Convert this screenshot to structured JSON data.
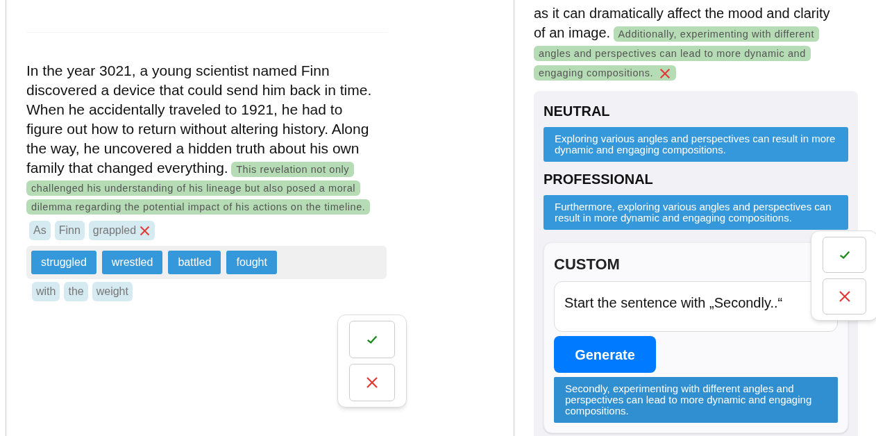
{
  "left_screen": {
    "story_text": "In the year 3021, a young scientist named Finn discovered a device that could send him back in time. When he accidentally traveled to 1921, he had to figure out how to return without altering history. Along the way, he uncovered a hidden truth about his own family that changed everything.",
    "suggestion": {
      "text": "This revelation not only challenged his understanding of his lineage but also posed a moral dilemma regarding the potential impact of his actions on the timeline.",
      "removable": false
    },
    "words": [
      {
        "text": "As",
        "removable": false
      },
      {
        "text": "Finn",
        "removable": false
      },
      {
        "text": "grappled",
        "removable": true
      }
    ],
    "options": [
      "struggled",
      "wrestled",
      "battled",
      "fought"
    ],
    "next_words": [
      {
        "text": "with",
        "removable": false
      },
      {
        "text": "the",
        "removable": false
      },
      {
        "text": "weight",
        "removable": false
      }
    ]
  },
  "right_screen": {
    "story_text": "as it can dramatically affect the mood and clarity of an image.",
    "suggestion": {
      "text": "Additionally, experimenting with different angles and perspectives can lead to more dynamic and engaging compositions.",
      "removable": true
    },
    "styles": [
      {
        "title": "NEUTRAL",
        "text": "Exploring various angles and perspectives can result in more dynamic and engaging compositions."
      },
      {
        "title": "PROFESSIONAL",
        "text": "Furthermore, exploring various angles and perspectives can result in more dynamic and engaging compositions."
      }
    ],
    "custom": {
      "title": "CUSTOM",
      "prompt": "Start the sentence with „Secondly..“",
      "button": "Generate",
      "result": "Secondly, experimenting with different angles and perspectives can lead to more dynamic and engaging compositions."
    }
  }
}
